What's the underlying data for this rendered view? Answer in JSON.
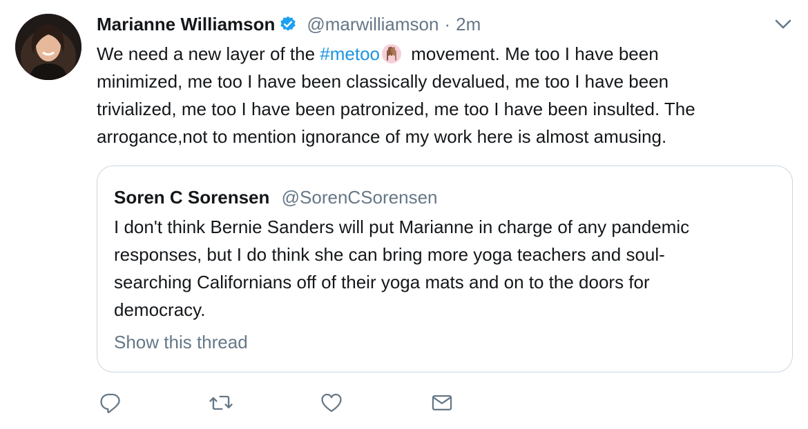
{
  "tweet": {
    "author": {
      "display_name": "Marianne Williamson",
      "handle": "@marwilliamson",
      "verified": true,
      "avatar": "profile-photo"
    },
    "separator": "·",
    "time": "2m",
    "text_lines": {
      "l1_pre": "We need a new layer of the ",
      "l1_hashtag": "#metoo",
      "l1_post": " movement. Me too I have been",
      "l2": "minimized, me too I have been classically devalued, me too I have been",
      "l3": "trivialized, me too I have been patronized, me too I have been insulted. The",
      "l4": "arrogance,not to mention ignorance of my work here is almost amusing."
    },
    "hashtag_emoji": "raised-hands-emoji",
    "menu_icon": "chevron-down-icon"
  },
  "quote": {
    "display_name": "Soren C Sorensen",
    "handle": "@SorenCSorensen",
    "text_lines": [
      "I don't think Bernie Sanders will put Marianne in charge of any pandemic",
      "responses, but I do think she can bring more yoga teachers and soul-",
      "searching Californians off of their yoga mats and on to the doors for",
      "democracy."
    ],
    "show_thread": "Show this thread"
  },
  "actions": {
    "reply_icon": "reply-icon",
    "retweet_icon": "retweet-icon",
    "like_icon": "heart-icon",
    "dm_icon": "envelope-icon"
  },
  "colors": {
    "link": "#1b95e0",
    "secondary_text": "#657786",
    "primary_text": "#14171a",
    "border": "#ccd6dd",
    "icon": "#657786",
    "verified": "#1da1f2"
  }
}
